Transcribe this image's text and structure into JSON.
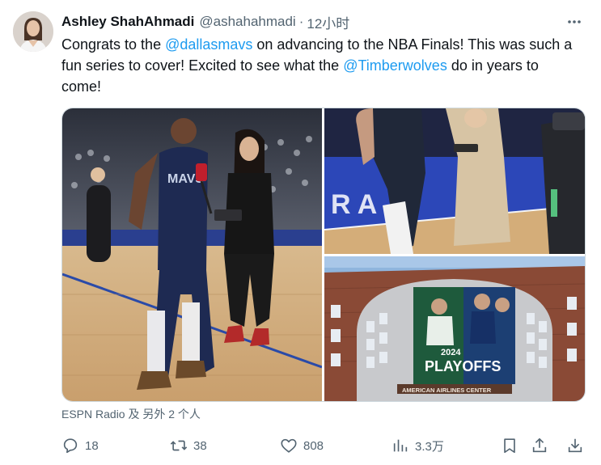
{
  "tweet": {
    "display_name": "Ashley ShahAhmadi",
    "handle": "@ashahahmadi",
    "separator": "·",
    "time": "12小时",
    "text_parts": {
      "p1": "Congrats to the ",
      "m1": "@dallasmavs",
      "p2": " on advancing to the NBA Finals! This was such a fun series to cover! Excited to see what the ",
      "m2": "@Timberwolves",
      "p3": " do in years to come!"
    },
    "media_tagged": "ESPN Radio 及 另外 2 个人",
    "media_texts": {
      "jersey_text": "MAVS",
      "arena_banner_year": "2024",
      "arena_banner_title": "PLAYOFFS",
      "arena_sign": "AMERICAN AIRLINES CENTER"
    }
  },
  "actions": {
    "reply_count": "18",
    "retweet_count": "38",
    "like_count": "808",
    "views_count": "3.3万"
  },
  "icons": [
    "more-icon",
    "reply-icon",
    "retweet-icon",
    "like-icon",
    "views-icon",
    "bookmark-icon",
    "share-icon",
    "download-icon"
  ],
  "colors": {
    "link": "#1d9bf0",
    "muted": "#536471",
    "text": "#0f1419"
  }
}
